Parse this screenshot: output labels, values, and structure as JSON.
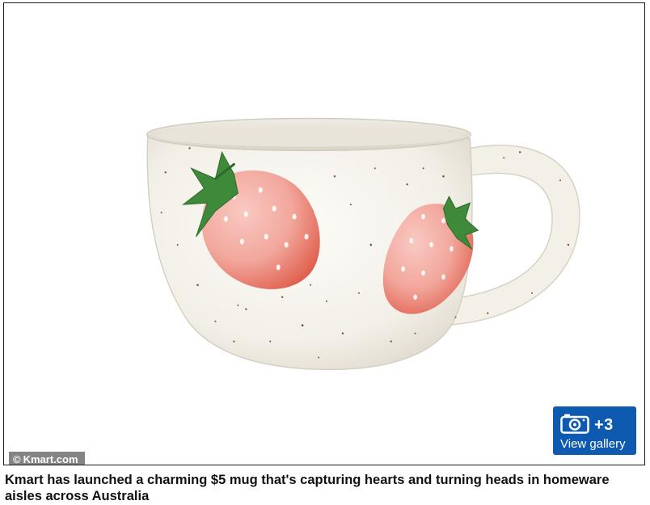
{
  "image": {
    "alt": "White speckled ceramic mug with pink strawberries"
  },
  "credit": {
    "symbol": "©",
    "text": "Kmart.com"
  },
  "gallery": {
    "icon": "camera-icon",
    "count": "+3",
    "label": "View gallery",
    "color": "#0d5ab0"
  },
  "caption": {
    "text": "Kmart has launched a charming $5 mug that's capturing hearts and turning heads in homeware aisles across Australia"
  }
}
